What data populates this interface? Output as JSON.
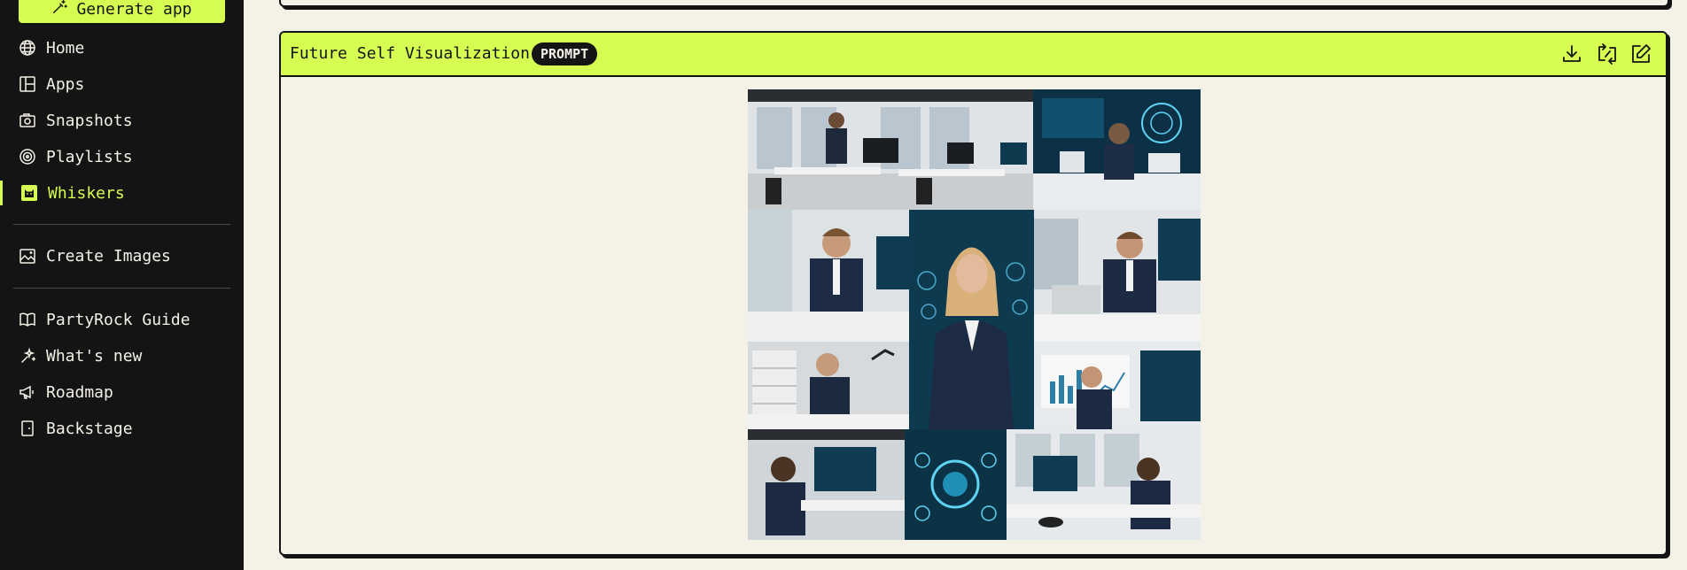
{
  "sidebar": {
    "generate_label": "Generate app",
    "items": [
      {
        "label": "Home"
      },
      {
        "label": "Apps"
      },
      {
        "label": "Snapshots"
      },
      {
        "label": "Playlists"
      },
      {
        "label": "Whiskers"
      },
      {
        "label": "Create Images"
      },
      {
        "label": "PartyRock Guide"
      },
      {
        "label": "What's new"
      },
      {
        "label": "Roadmap"
      },
      {
        "label": "Backstage"
      }
    ],
    "active_item": "Whiskers"
  },
  "widget": {
    "title": "Future Self Visualization",
    "badge": "PROMPT",
    "actions": [
      "download-icon",
      "regenerate-icon",
      "edit-icon"
    ]
  },
  "colors": {
    "accent": "#d6fd52",
    "sidebar_bg": "#141414",
    "page_bg": "#f4f1e7"
  }
}
